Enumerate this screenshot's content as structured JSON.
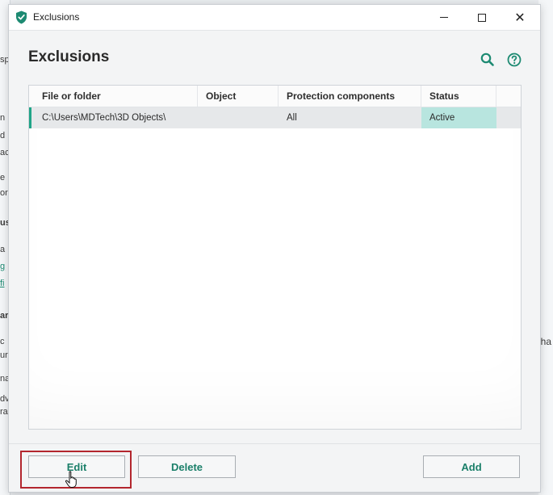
{
  "window": {
    "title": "Exclusions",
    "controls": {
      "minimize": "minimize",
      "maximize": "maximize",
      "close": "✕"
    }
  },
  "page": {
    "heading": "Exclusions",
    "tools": {
      "search_icon": "search-icon",
      "help_icon": "help-icon"
    }
  },
  "table": {
    "columns": [
      "File or folder",
      "Object",
      "Protection components",
      "Status"
    ],
    "rows": [
      {
        "file_or_folder": "C:\\Users\\MDTech\\3D Objects\\",
        "object": "",
        "protection_components": "All",
        "status": "Active"
      }
    ]
  },
  "buttons": {
    "edit": "Edit",
    "delete": "Delete",
    "add": "Add"
  },
  "background_fragments": {
    "left": [
      "sp",
      "n",
      "d",
      "ac",
      "e",
      "or",
      "us",
      "a",
      "g",
      "fi",
      "ar",
      "c",
      "ur",
      "na",
      "dv",
      "ra"
    ],
    "right": "ha"
  },
  "colors": {
    "accent": "#20a487",
    "button_text": "#1a7f69",
    "status_cell": "#b8e5df",
    "highlight_box": "#b3262e"
  }
}
